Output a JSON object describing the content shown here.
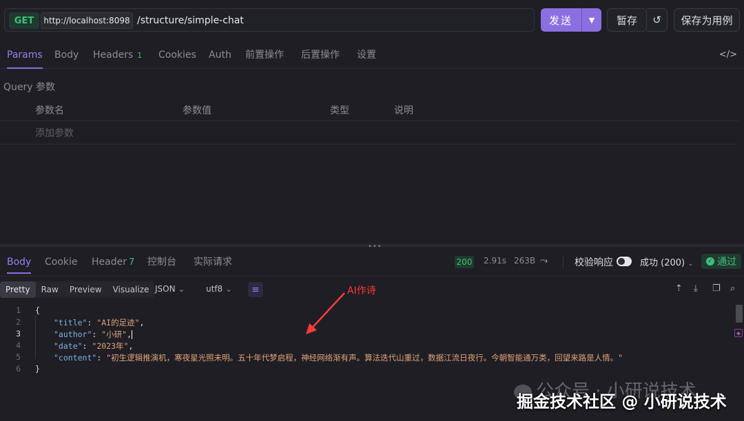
{
  "request": {
    "method": "GET",
    "host": "http://localhost:8098",
    "path": "/structure/simple-chat",
    "send_label": "发送",
    "save_draft_label": "暂存",
    "save_example_label": "保存为用例"
  },
  "request_tabs": [
    {
      "label": "Params"
    },
    {
      "label": "Body"
    },
    {
      "label": "Headers",
      "count": "1"
    },
    {
      "label": "Cookies"
    },
    {
      "label": "Auth"
    },
    {
      "label": "前置操作"
    },
    {
      "label": "后置操作"
    },
    {
      "label": "设置"
    }
  ],
  "query": {
    "title": "Query 参数",
    "columns": [
      "参数名",
      "参数值",
      "类型",
      "说明"
    ],
    "add_placeholder": "添加参数"
  },
  "response_tabs": [
    {
      "label": "Body"
    },
    {
      "label": "Cookie"
    },
    {
      "label": "Header",
      "count": "7"
    },
    {
      "label": "控制台"
    },
    {
      "label": "实际请求"
    }
  ],
  "response_meta": {
    "status_code": "200",
    "time": "2.91s",
    "size": "263B",
    "validate_label": "校验响应",
    "success_select": "成功 (200)",
    "pass_label": "通过"
  },
  "viewer": {
    "modes": [
      "Pretty",
      "Raw",
      "Preview",
      "Visualize"
    ],
    "format": "JSON",
    "encoding": "utf8"
  },
  "code": {
    "line_numbers": [
      "1",
      "2",
      "3",
      "4",
      "5",
      "6"
    ],
    "open_brace": "{",
    "close_brace": "}",
    "fields": [
      {
        "key": "\"title\"",
        "value": "\"AI的足迹\""
      },
      {
        "key": "\"author\"",
        "value": "\"小研\""
      },
      {
        "key": "\"date\"",
        "value": "\"2023年\""
      },
      {
        "key": "\"content\"",
        "value": "\"初生逻辑推演机，寒夜星光照未明。五十年代梦启程，神经网络渐有声。算法迭代山重过，数据江流日夜行。今朝智能通万类，回望来路是人情。\""
      }
    ]
  },
  "annotation": "AI作诗",
  "watermarks": {
    "top": "公众号 · 小研说技术",
    "bottom": "掘金技术社区 @ 小研说技术"
  },
  "colors": {
    "accent": "#8b6fe0",
    "success": "#3fbf7f",
    "annotation": "#ff3b3b"
  }
}
